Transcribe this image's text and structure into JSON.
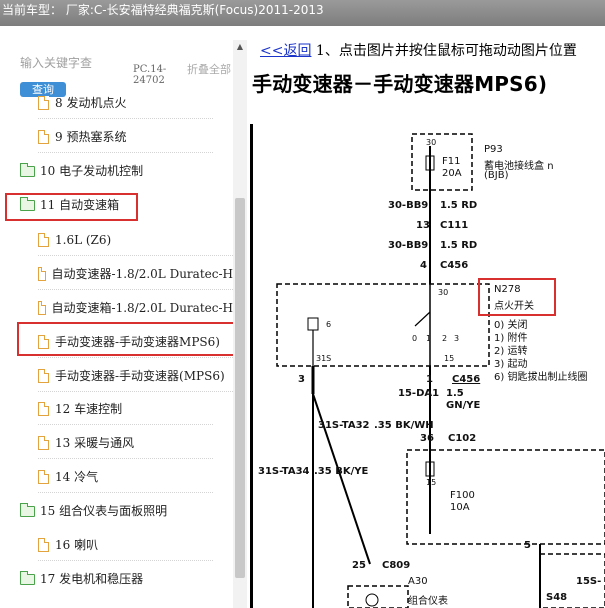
{
  "window": {
    "title": "当前车型： 厂家:C-长安福特经典福克斯(Focus)2011-2013"
  },
  "sidebar": {
    "search_placeholder": "输入关键字查",
    "query_label": "查询",
    "code": "PC.14-24702",
    "collapse_label": "折叠全部",
    "items": [
      {
        "label": "8 发动机点火",
        "kind": "doc"
      },
      {
        "label": "9 预热塞系统",
        "kind": "doc"
      },
      {
        "label": "10 电子发动机控制",
        "kind": "folder"
      },
      {
        "label": "11 自动变速箱",
        "kind": "folder",
        "highlighted": true
      },
      {
        "label": "1.6L (Z6)",
        "kind": "doc"
      },
      {
        "label": "自动变速器-1.8/2.0L Duratec-H",
        "kind": "doc"
      },
      {
        "label": "自动变速箱-1.8/2.0L Duratec-H",
        "kind": "doc"
      },
      {
        "label": "手动变速器-手动变速器MPS6)",
        "kind": "doc",
        "highlighted": true
      },
      {
        "label": "手动变速器-手动变速器(MPS6)",
        "kind": "doc"
      },
      {
        "label": "12 车速控制",
        "kind": "doc"
      },
      {
        "label": "13 采暖与通风",
        "kind": "doc"
      },
      {
        "label": "14 冷气",
        "kind": "doc"
      },
      {
        "label": "15 组合仪表与面板照明",
        "kind": "folder"
      },
      {
        "label": "16 喇叭",
        "kind": "doc"
      },
      {
        "label": "17 发电机和稳压器",
        "kind": "folder"
      }
    ]
  },
  "content": {
    "back_link": "<<返回",
    "instruction": "1、点击图片并按住鼠标可拖动动图片位置",
    "diagram": {
      "title": "手动变速器－手动变速器MPS6)",
      "p93": "P93",
      "p93_desc": "蓄电池接线盒",
      "p93_n": "n",
      "bjb": "(BJB)",
      "fuse_30": "30",
      "f11": "F11",
      "f11_amp": "20A",
      "w1_code": "30-BB9",
      "w1_size": "1.5 RD",
      "c111_pin": "13",
      "c111": "C111",
      "w2_code": "30-BB9",
      "w2_size": "1.5 RD",
      "c456_pin_top": "4",
      "c456_top": "C456",
      "sw_30": "30",
      "n278": "N278",
      "n278_desc": "点火开关",
      "pos0": "0) 关闭",
      "pos1": "1) 附件",
      "pos2": "2) 运转",
      "pos3": "3) 起动",
      "pos6": "6) 钥匙拔出制止线圈",
      "relay_pin6": "6",
      "sw_0": "0",
      "sw_1": "1",
      "sw_2": "2",
      "sw_3": "3",
      "pin_31s": "31S",
      "pin_15": "15",
      "pin3": "3",
      "pin1": "1",
      "c456_b": "C456",
      "w3_code": "15-DA1",
      "w3_size": "1.5",
      "w3_color": "GN/YE",
      "c102_pin": "36",
      "c102": "C102",
      "w4_code": "31S-TA32",
      "w4_size": ".35 BK/WH",
      "w5_code": "31S-TA34",
      "w5_size": ".35 BK/YE",
      "f100_15": "15",
      "f100": "F100",
      "f100_amp": "10A",
      "pin5": "5",
      "c809_pin": "25",
      "c809": "C809",
      "a30": "A30",
      "a30_desc": "组合仪表",
      "w6_code": "15S-",
      "s48": "S48"
    }
  },
  "colors": {
    "highlight": "#d7302f",
    "link": "#1a33c8",
    "query_button": "#3f8fd6",
    "folder": "#4aa34a",
    "doc": "#e3a43f"
  }
}
